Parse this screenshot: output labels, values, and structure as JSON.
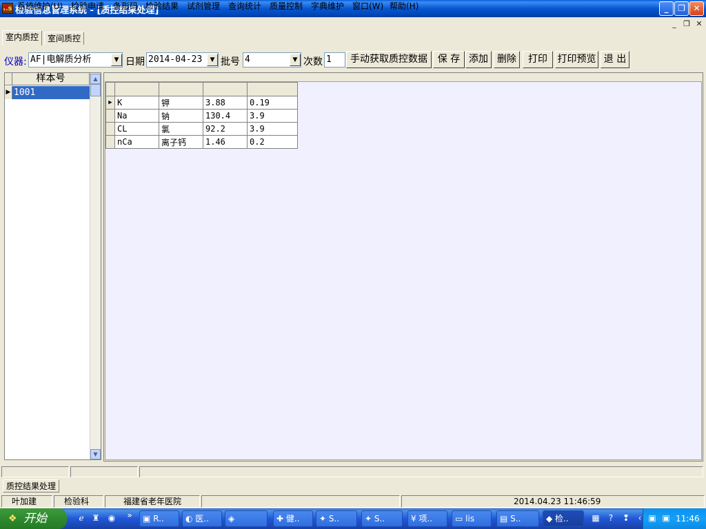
{
  "window": {
    "app_icon": "lis",
    "title": "检验信息管理系统 - [质控结果处理]"
  },
  "menu": {
    "items": [
      "系统维护(U)",
      "检验申请",
      "条形码",
      "检验结果",
      "试剂管理",
      "查询统计",
      "质量控制",
      "字典维护",
      "窗口(W)",
      "帮助(H)"
    ]
  },
  "tabs": {
    "items": [
      "室内质控",
      "室间质控"
    ],
    "active": 0
  },
  "toolbar": {
    "instrument_label": "仪器:",
    "instrument_value": "AF|电解质分析",
    "date_label": "日期",
    "date_value": "2014-04-23",
    "batch_label": "批号",
    "batch_value": "4",
    "count_label": "次数",
    "count_value": "1",
    "buttons": [
      "手动获取质控数据",
      "保 存",
      "添加",
      "删除",
      "打印",
      "打印预览",
      "退 出"
    ]
  },
  "sample_list": {
    "header": "样本号",
    "rows": [
      "1001"
    ]
  },
  "qc_table": {
    "rows": [
      {
        "code": "K",
        "name": "钾",
        "value": "3.88",
        "sd": "0.19"
      },
      {
        "code": "Na",
        "name": "钠",
        "value": "130.4",
        "sd": "3.9"
      },
      {
        "code": "CL",
        "name": "氯",
        "value": "92.2",
        "sd": "3.9"
      },
      {
        "code": "nCa",
        "name": "离子钙",
        "value": "1.46",
        "sd": "0.2"
      }
    ]
  },
  "form_tab": "质控结果处理",
  "status": {
    "user": "叶加建",
    "dept": "检验科",
    "hospital": "福建省老年医院",
    "datetime": "2014.04.23 11:46:59"
  },
  "taskbar": {
    "start": "开始",
    "tasks": [
      "R..",
      "医..",
      "",
      "健..",
      "S..",
      "S..",
      "项..",
      "lis",
      "S..",
      "检.."
    ],
    "clock": "11:46"
  },
  "colors": {
    "title_bar": "#0856d0",
    "selection": "#316ac5",
    "grid_bg": "#f0f0ff"
  }
}
